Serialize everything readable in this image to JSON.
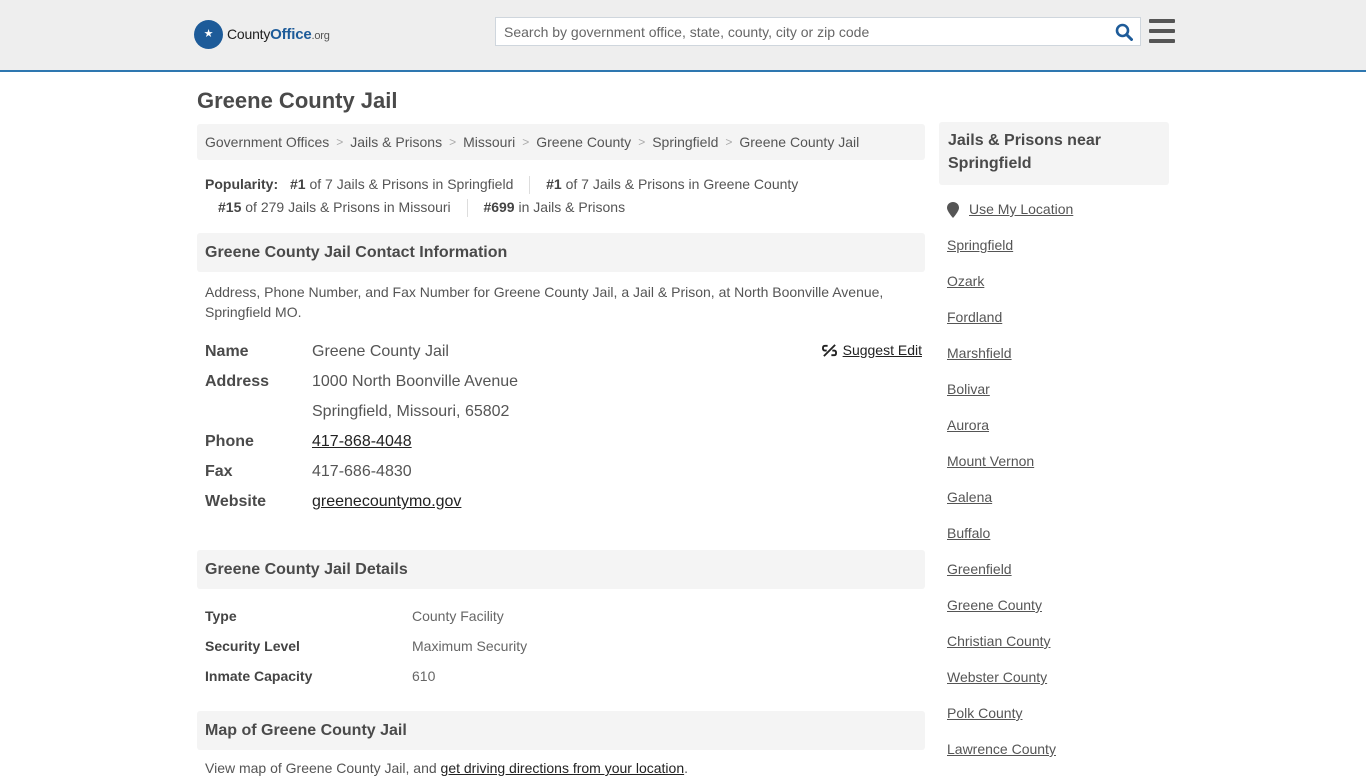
{
  "header": {
    "logo": {
      "prefix": "County",
      "brand": "Office",
      "suffix": ".org"
    },
    "search": {
      "placeholder": "Search by government office, state, county, city or zip code",
      "value": ""
    },
    "icons": {
      "search": "search-icon",
      "menu": "hamburger-menu-icon"
    }
  },
  "page_title": "Greene County Jail",
  "breadcrumb": [
    "Government Offices",
    "Jails & Prisons",
    "Missouri",
    "Greene County",
    "Springfield",
    "Greene County Jail"
  ],
  "breadcrumb_sep": ">",
  "popularity": {
    "label": "Popularity:",
    "items": [
      {
        "rank": "#1",
        "text": " of 7 Jails & Prisons in Springfield"
      },
      {
        "rank": "#1",
        "text": " of 7 Jails & Prisons in Greene County"
      },
      {
        "rank": "#15",
        "text": " of 279 Jails & Prisons in Missouri"
      },
      {
        "rank": "#699",
        "text": " in Jails & Prisons"
      }
    ]
  },
  "contact": {
    "heading": "Greene County Jail Contact Information",
    "description": "Address, Phone Number, and Fax Number for Greene County Jail, a Jail & Prison, at North Boonville Avenue, Springfield MO.",
    "suggest_edit": "Suggest Edit",
    "rows": {
      "name": {
        "label": "Name",
        "value": "Greene County Jail"
      },
      "address": {
        "label": "Address",
        "line1": "1000 North Boonville Avenue",
        "line2": "Springfield, Missouri, 65802"
      },
      "phone": {
        "label": "Phone",
        "value": "417-868-4048"
      },
      "fax": {
        "label": "Fax",
        "value": "417-686-4830"
      },
      "website": {
        "label": "Website",
        "value": "greenecountymo.gov"
      }
    }
  },
  "details": {
    "heading": "Greene County Jail Details",
    "rows": [
      {
        "label": "Type",
        "value": "County Facility"
      },
      {
        "label": "Security Level",
        "value": "Maximum Security"
      },
      {
        "label": "Inmate Capacity",
        "value": "610"
      }
    ]
  },
  "map": {
    "heading": "Map of Greene County Jail",
    "text": "View map of Greene County Jail, and ",
    "link": "get driving directions from your location",
    "text_end": "."
  },
  "sidebar": {
    "heading": "Jails & Prisons near Springfield",
    "use_location": "Use My Location",
    "items": [
      "Springfield",
      "Ozark",
      "Fordland",
      "Marshfield",
      "Bolivar",
      "Aurora",
      "Mount Vernon",
      "Galena",
      "Buffalo",
      "Greenfield",
      "Greene County",
      "Christian County",
      "Webster County",
      "Polk County",
      "Lawrence County"
    ]
  },
  "colors": {
    "accent": "#2e77b0",
    "brand": "#1d5b99",
    "header_bg": "#eeeeee",
    "panel_bg": "#f4f4f4"
  }
}
